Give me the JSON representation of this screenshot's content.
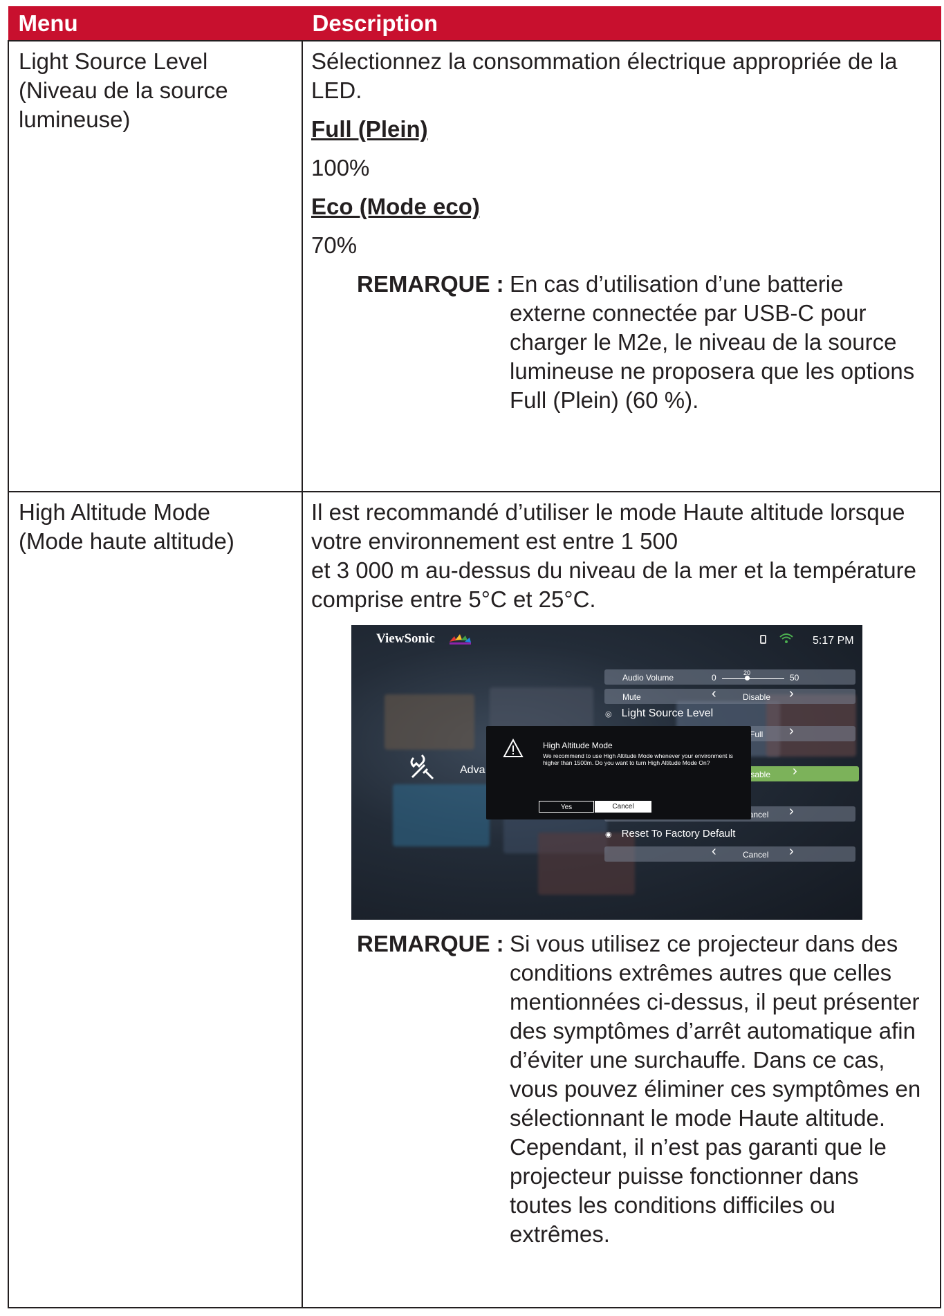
{
  "table": {
    "headers": [
      "Menu",
      "Description"
    ],
    "rows": [
      {
        "menu": "Light Source Level\n(Niveau de la source\nlumineuse)",
        "intro": "Sélectionnez la consommation électrique appropriée de la LED.",
        "options": [
          {
            "title": "Full (Plein)",
            "value": "100%"
          },
          {
            "title": "Eco (Mode eco)",
            "value": "70%"
          }
        ],
        "note_label": "REMARQUE :",
        "note": "En cas d’utilisation d’une batterie externe connectée par USB-C pour charger le M2e, le niveau de la source lumineuse ne proposera que les options Full (Plein) (60 %)."
      },
      {
        "menu": "High Altitude Mode\n(Mode haute altitude)",
        "intro": "Il est recommandé d’utiliser le mode Haute altitude lorsque votre environnement est entre 1 500\net 3 000 m au-dessus du niveau de la mer et la température comprise entre 5°C et 25°C.",
        "note_label": "REMARQUE :",
        "note": "Si vous utilisez ce projecteur dans des conditions extrêmes autres que celles mentionnées ci-dessus, il peut présenter des symptômes d’arrêt automatique afin d’éviter une surchauffe. Dans ce cas, vous pouvez éliminer ces symptômes en sélectionnant le mode Haute altitude. Cependant, il n’est pas garanti que le projecteur puisse fonctionner dans toutes les conditions difficiles ou extrêmes."
      }
    ]
  },
  "screenshot": {
    "brand": "ViewSonic",
    "time": "5:17 PM",
    "audio_volume_label": "Audio Volume",
    "audio_min": "0",
    "audio_value": "20",
    "audio_max": "50",
    "audio_level_fraction": 0.4,
    "mute_label": "Mute",
    "mute_value": "Disable",
    "light_source_label": "Light Source Level",
    "light_source_value": "Full",
    "high_altitude_value": "Disable",
    "reset_settings_value": "Cancel",
    "reset_factory_label": "Reset To Factory Default",
    "reset_factory_value": "Cancel",
    "advanced_label": "Adva",
    "dialog_title": "High Altitude Mode",
    "dialog_body": "We recommend to use High Altitude Mode whenever your environment is higher than 1500m. Do you want to turn High Altitude Mode On?",
    "yes_label": "Yes",
    "cancel_label": "Cancel",
    "accent_color": "#8bc34a"
  },
  "colors": {
    "header_bg": "#c8102e",
    "header_text": "#ffffff",
    "text": "#231f20"
  }
}
